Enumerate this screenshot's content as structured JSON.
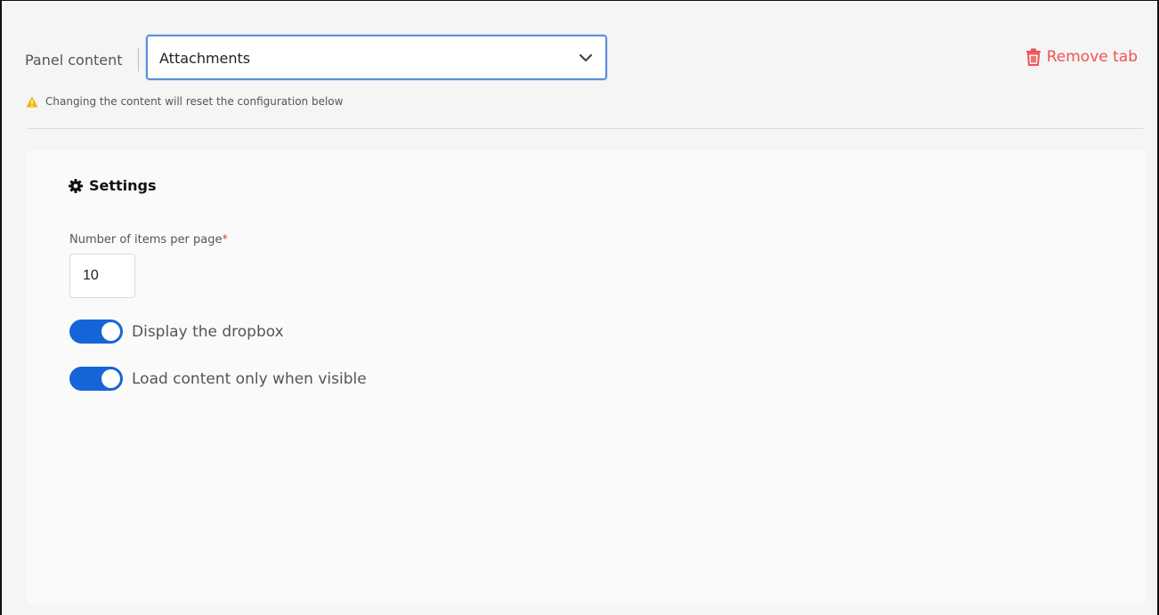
{
  "header": {
    "panel_content_label": "Panel content",
    "select": {
      "selected_value": "Attachments",
      "icon": "chevron-down-icon"
    },
    "remove_tab": {
      "label": "Remove tab",
      "icon": "trash-icon",
      "color": "#ef5350"
    },
    "warning": {
      "text": "Changing the content will reset the configuration below",
      "icon": "warning-icon",
      "color": "#f5b400"
    }
  },
  "settings": {
    "title": "Settings",
    "icon": "gear-icon",
    "items_per_page": {
      "label": "Number of items per page",
      "required_marker": "*",
      "value": "10"
    },
    "toggles": [
      {
        "label": "Display the dropbox",
        "enabled": true
      },
      {
        "label": "Load content only when visible",
        "enabled": true
      }
    ],
    "accent_color": "#1565d8"
  }
}
